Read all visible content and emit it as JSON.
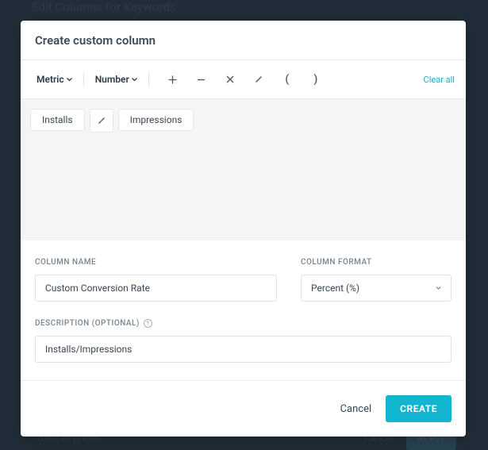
{
  "background": {
    "header": "Edit Columns for Keywords",
    "preset": "Save as preset",
    "cancel": "Cancel",
    "apply": "APPLY"
  },
  "modal": {
    "title": "Create custom column",
    "toolbar": {
      "metric": "Metric",
      "number": "Number",
      "clear": "Clear all"
    },
    "chips": {
      "0": "Installs",
      "1": "Impressions"
    },
    "form": {
      "name_label": "COLUMN NAME",
      "name_value": "Custom Conversion Rate",
      "format_label": "COLUMN FORMAT",
      "format_value": "Percent (%)",
      "desc_label": "DESCRIPTION (OPTIONAL)",
      "desc_value": "Installs/Impressions"
    },
    "footer": {
      "cancel": "Cancel",
      "create": "CREATE"
    }
  }
}
